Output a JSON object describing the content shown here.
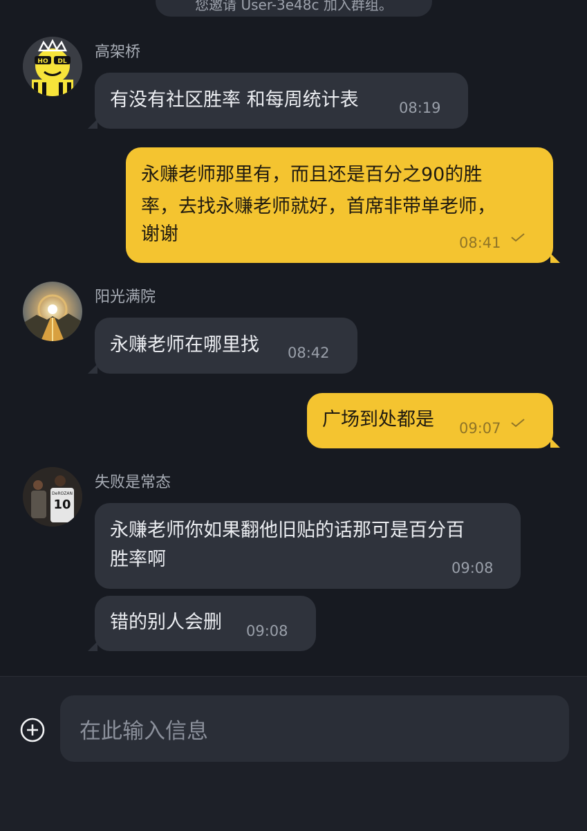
{
  "system_message": {
    "text": "您邀请 User-3e48c 加入群组。"
  },
  "messages": [
    {
      "sender": "高架桥",
      "text": "有没有社区胜率 和每周统计表",
      "time": "08:19"
    },
    {
      "lines": [
        "永赚老师那里有，而且还是百分之90的胜",
        "率，去找永赚老师就好，首席非带单老师，",
        "谢谢"
      ],
      "time": "08:41"
    },
    {
      "sender": "阳光满院",
      "text": "永赚老师在哪里找",
      "time": "08:42"
    },
    {
      "text": "广场到处都是",
      "time": "09:07"
    },
    {
      "sender": "失败是常态",
      "lines": [
        "永赚老师你如果翻他旧贴的话那可是百分百",
        "胜率啊"
      ],
      "time": "09:08"
    },
    {
      "text": "错的别人会删",
      "time": "09:08"
    }
  ],
  "avatars": {
    "gaojiaqiao": {
      "badge_left": "HO",
      "badge_right": "DL"
    },
    "shibai": {
      "jersey_name": "DeROZAN",
      "jersey_number": "10"
    }
  },
  "composer": {
    "placeholder": "在此输入信息"
  },
  "colors": {
    "background": "#171a21",
    "incoming": "#2f333c",
    "outgoing": "#f4c430"
  }
}
